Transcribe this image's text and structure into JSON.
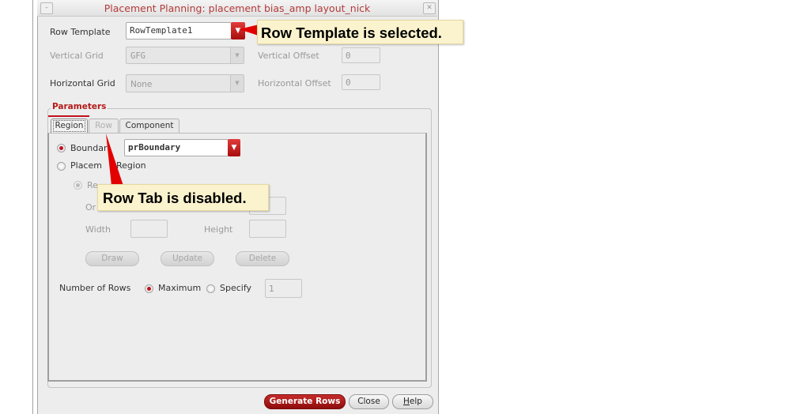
{
  "window": {
    "title": "Placement Planning: placement bias_amp layout_nick",
    "minimize_glyph": "–",
    "close_glyph": "✕"
  },
  "top": {
    "row_template_label": "Row Template",
    "row_template_value": "RowTemplate1",
    "vertical_grid_label": "Vertical Grid",
    "vertical_grid_value": "GFG",
    "vertical_offset_label": "Vertical Offset",
    "vertical_offset_value": "0",
    "horizontal_grid_label": "Horizontal Grid",
    "horizontal_grid_value": "None",
    "horizontal_offset_label": "Horizontal Offset",
    "horizontal_offset_value": "0"
  },
  "parameters": {
    "legend": "Parameters",
    "tabs": [
      {
        "label": "Region",
        "state": "active"
      },
      {
        "label": "Row",
        "state": "disabled"
      },
      {
        "label": "Component",
        "state": "normal"
      }
    ],
    "region": {
      "boundary_label": "Boundar",
      "boundary_selected": true,
      "boundary_value": "prBoundary",
      "placement_region_label_a": "Placem",
      "placement_region_label_b": "Region",
      "rect_label": "Re",
      "origin_label": "Or",
      "width_label": "Width",
      "height_label": "Height",
      "draw_label": "Draw",
      "update_label": "Update",
      "delete_label": "Delete",
      "number_of_rows_label": "Number of Rows",
      "maximum_label": "Maximum",
      "specify_label": "Specify",
      "rows_mode": "Maximum",
      "rows_value": "1"
    }
  },
  "footer": {
    "generate_rows_label": "Generate Rows",
    "close_label": "Close",
    "help_label": "Help"
  },
  "annotations": {
    "row_template_callout": "Row Template is selected.",
    "row_tab_callout": "Row Tab is disabled."
  },
  "colors": {
    "accent_red": "#c1121f",
    "callout_bg": "#fbf3cd"
  }
}
